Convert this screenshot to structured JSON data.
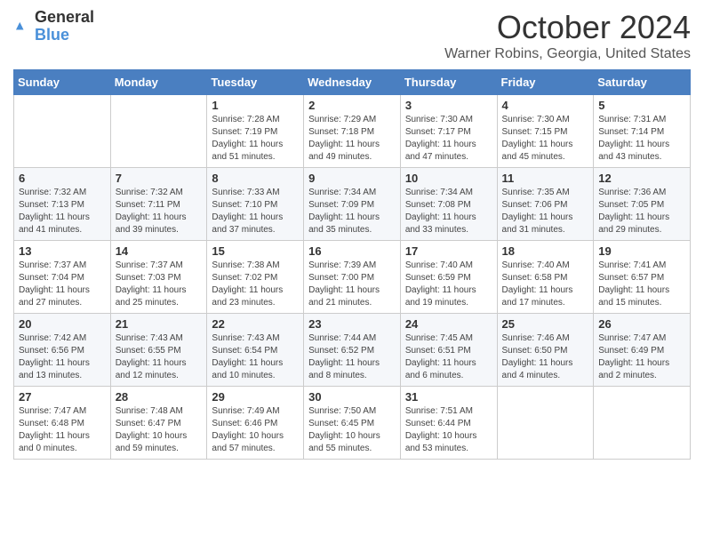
{
  "header": {
    "logo_general": "General",
    "logo_blue": "Blue",
    "month_title": "October 2024",
    "location": "Warner Robins, Georgia, United States"
  },
  "weekdays": [
    "Sunday",
    "Monday",
    "Tuesday",
    "Wednesday",
    "Thursday",
    "Friday",
    "Saturday"
  ],
  "weeks": [
    [
      {
        "day": "",
        "sunrise": "",
        "sunset": "",
        "daylight": ""
      },
      {
        "day": "",
        "sunrise": "",
        "sunset": "",
        "daylight": ""
      },
      {
        "day": "1",
        "sunrise": "Sunrise: 7:28 AM",
        "sunset": "Sunset: 7:19 PM",
        "daylight": "Daylight: 11 hours and 51 minutes."
      },
      {
        "day": "2",
        "sunrise": "Sunrise: 7:29 AM",
        "sunset": "Sunset: 7:18 PM",
        "daylight": "Daylight: 11 hours and 49 minutes."
      },
      {
        "day": "3",
        "sunrise": "Sunrise: 7:30 AM",
        "sunset": "Sunset: 7:17 PM",
        "daylight": "Daylight: 11 hours and 47 minutes."
      },
      {
        "day": "4",
        "sunrise": "Sunrise: 7:30 AM",
        "sunset": "Sunset: 7:15 PM",
        "daylight": "Daylight: 11 hours and 45 minutes."
      },
      {
        "day": "5",
        "sunrise": "Sunrise: 7:31 AM",
        "sunset": "Sunset: 7:14 PM",
        "daylight": "Daylight: 11 hours and 43 minutes."
      }
    ],
    [
      {
        "day": "6",
        "sunrise": "Sunrise: 7:32 AM",
        "sunset": "Sunset: 7:13 PM",
        "daylight": "Daylight: 11 hours and 41 minutes."
      },
      {
        "day": "7",
        "sunrise": "Sunrise: 7:32 AM",
        "sunset": "Sunset: 7:11 PM",
        "daylight": "Daylight: 11 hours and 39 minutes."
      },
      {
        "day": "8",
        "sunrise": "Sunrise: 7:33 AM",
        "sunset": "Sunset: 7:10 PM",
        "daylight": "Daylight: 11 hours and 37 minutes."
      },
      {
        "day": "9",
        "sunrise": "Sunrise: 7:34 AM",
        "sunset": "Sunset: 7:09 PM",
        "daylight": "Daylight: 11 hours and 35 minutes."
      },
      {
        "day": "10",
        "sunrise": "Sunrise: 7:34 AM",
        "sunset": "Sunset: 7:08 PM",
        "daylight": "Daylight: 11 hours and 33 minutes."
      },
      {
        "day": "11",
        "sunrise": "Sunrise: 7:35 AM",
        "sunset": "Sunset: 7:06 PM",
        "daylight": "Daylight: 11 hours and 31 minutes."
      },
      {
        "day": "12",
        "sunrise": "Sunrise: 7:36 AM",
        "sunset": "Sunset: 7:05 PM",
        "daylight": "Daylight: 11 hours and 29 minutes."
      }
    ],
    [
      {
        "day": "13",
        "sunrise": "Sunrise: 7:37 AM",
        "sunset": "Sunset: 7:04 PM",
        "daylight": "Daylight: 11 hours and 27 minutes."
      },
      {
        "day": "14",
        "sunrise": "Sunrise: 7:37 AM",
        "sunset": "Sunset: 7:03 PM",
        "daylight": "Daylight: 11 hours and 25 minutes."
      },
      {
        "day": "15",
        "sunrise": "Sunrise: 7:38 AM",
        "sunset": "Sunset: 7:02 PM",
        "daylight": "Daylight: 11 hours and 23 minutes."
      },
      {
        "day": "16",
        "sunrise": "Sunrise: 7:39 AM",
        "sunset": "Sunset: 7:00 PM",
        "daylight": "Daylight: 11 hours and 21 minutes."
      },
      {
        "day": "17",
        "sunrise": "Sunrise: 7:40 AM",
        "sunset": "Sunset: 6:59 PM",
        "daylight": "Daylight: 11 hours and 19 minutes."
      },
      {
        "day": "18",
        "sunrise": "Sunrise: 7:40 AM",
        "sunset": "Sunset: 6:58 PM",
        "daylight": "Daylight: 11 hours and 17 minutes."
      },
      {
        "day": "19",
        "sunrise": "Sunrise: 7:41 AM",
        "sunset": "Sunset: 6:57 PM",
        "daylight": "Daylight: 11 hours and 15 minutes."
      }
    ],
    [
      {
        "day": "20",
        "sunrise": "Sunrise: 7:42 AM",
        "sunset": "Sunset: 6:56 PM",
        "daylight": "Daylight: 11 hours and 13 minutes."
      },
      {
        "day": "21",
        "sunrise": "Sunrise: 7:43 AM",
        "sunset": "Sunset: 6:55 PM",
        "daylight": "Daylight: 11 hours and 12 minutes."
      },
      {
        "day": "22",
        "sunrise": "Sunrise: 7:43 AM",
        "sunset": "Sunset: 6:54 PM",
        "daylight": "Daylight: 11 hours and 10 minutes."
      },
      {
        "day": "23",
        "sunrise": "Sunrise: 7:44 AM",
        "sunset": "Sunset: 6:52 PM",
        "daylight": "Daylight: 11 hours and 8 minutes."
      },
      {
        "day": "24",
        "sunrise": "Sunrise: 7:45 AM",
        "sunset": "Sunset: 6:51 PM",
        "daylight": "Daylight: 11 hours and 6 minutes."
      },
      {
        "day": "25",
        "sunrise": "Sunrise: 7:46 AM",
        "sunset": "Sunset: 6:50 PM",
        "daylight": "Daylight: 11 hours and 4 minutes."
      },
      {
        "day": "26",
        "sunrise": "Sunrise: 7:47 AM",
        "sunset": "Sunset: 6:49 PM",
        "daylight": "Daylight: 11 hours and 2 minutes."
      }
    ],
    [
      {
        "day": "27",
        "sunrise": "Sunrise: 7:47 AM",
        "sunset": "Sunset: 6:48 PM",
        "daylight": "Daylight: 11 hours and 0 minutes."
      },
      {
        "day": "28",
        "sunrise": "Sunrise: 7:48 AM",
        "sunset": "Sunset: 6:47 PM",
        "daylight": "Daylight: 10 hours and 59 minutes."
      },
      {
        "day": "29",
        "sunrise": "Sunrise: 7:49 AM",
        "sunset": "Sunset: 6:46 PM",
        "daylight": "Daylight: 10 hours and 57 minutes."
      },
      {
        "day": "30",
        "sunrise": "Sunrise: 7:50 AM",
        "sunset": "Sunset: 6:45 PM",
        "daylight": "Daylight: 10 hours and 55 minutes."
      },
      {
        "day": "31",
        "sunrise": "Sunrise: 7:51 AM",
        "sunset": "Sunset: 6:44 PM",
        "daylight": "Daylight: 10 hours and 53 minutes."
      },
      {
        "day": "",
        "sunrise": "",
        "sunset": "",
        "daylight": ""
      },
      {
        "day": "",
        "sunrise": "",
        "sunset": "",
        "daylight": ""
      }
    ]
  ]
}
